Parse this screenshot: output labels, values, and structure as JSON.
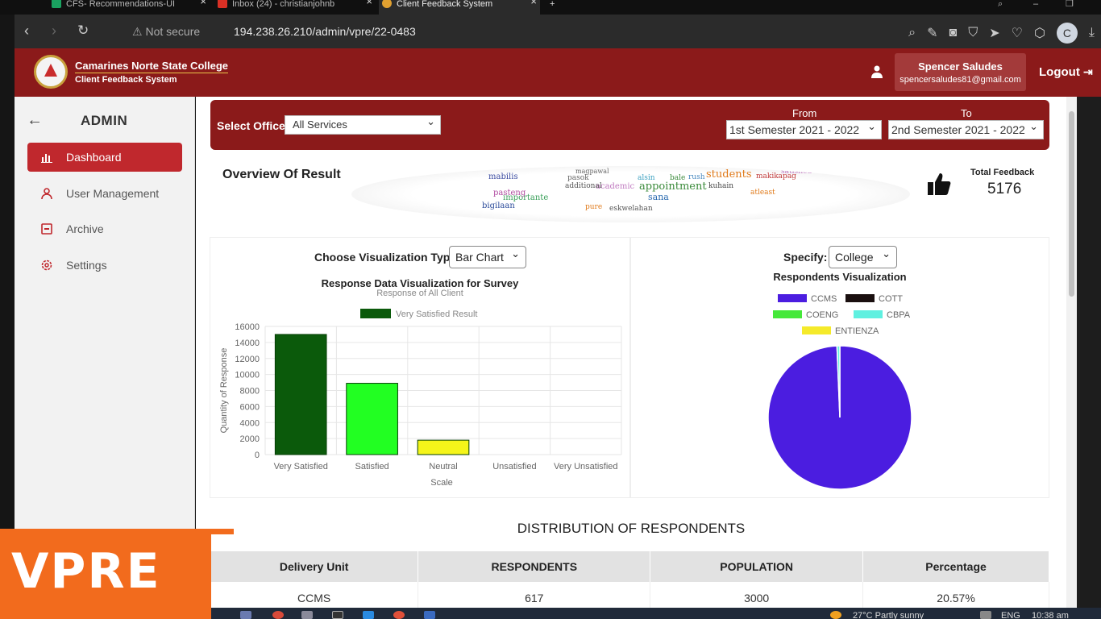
{
  "browser": {
    "tabs": [
      {
        "title": "CFS- Recommendations-UI",
        "favicon_color": "#1aa260"
      },
      {
        "title": "Inbox (24) - christianjohnb",
        "favicon_color": "#d93025"
      },
      {
        "title": "Client Feedback System",
        "favicon_color": "#e0a030"
      }
    ],
    "security": "Not secure",
    "url": "194.238.26.210/admin/vpre/22-0483",
    "profile_initial": "C"
  },
  "header": {
    "brand_title": "Camarines Norte State College",
    "brand_subtitle": "Client Feedback System",
    "user_name": "Spencer Saludes",
    "user_email": "spencersaludes81@gmail.com",
    "logout_label": "Logout"
  },
  "sidebar": {
    "title": "ADMIN",
    "items": [
      {
        "label": "Dashboard",
        "icon": "bar-chart-icon",
        "active": true
      },
      {
        "label": "User Management",
        "icon": "user-icon",
        "active": false
      },
      {
        "label": "Archive",
        "icon": "archive-icon",
        "active": false
      },
      {
        "label": "Settings",
        "icon": "gear-icon",
        "active": false
      }
    ]
  },
  "filters": {
    "office_label": "Select Office",
    "office_value": "All Services",
    "from_label": "From",
    "from_value": "1st Semester 2021 - 2022",
    "to_label": "To",
    "to_value": "2nd Semester 2021 - 2022"
  },
  "overview": {
    "title": "Overview Of Result",
    "total_label": "Total Feedback",
    "total_value": "5176",
    "word_cloud": [
      {
        "w": "appointment",
        "c": "#3a8a3a"
      },
      {
        "w": "students",
        "c": "#e07a1a"
      },
      {
        "w": "mabilis",
        "c": "#3a4aa0"
      },
      {
        "w": "sana",
        "c": "#2a6ab0"
      },
      {
        "w": "academic",
        "c": "#c07ac0"
      },
      {
        "w": "additional",
        "c": "#555"
      },
      {
        "w": "importante",
        "c": "#3aa05a"
      },
      {
        "w": "bigilaan",
        "c": "#2a4a9a"
      },
      {
        "w": "pasteng",
        "c": "#b04aa0"
      },
      {
        "w": "makikapag",
        "c": "#c03a3a"
      },
      {
        "w": "kuhain",
        "c": "#444"
      },
      {
        "w": "pasok",
        "c": "#666"
      },
      {
        "w": "atleast",
        "c": "#e07a1a"
      },
      {
        "w": "pure",
        "c": "#e07a1a"
      },
      {
        "w": "satisfied",
        "c": "#c07ac0"
      },
      {
        "w": "alsin",
        "c": "#3aa0c0"
      },
      {
        "w": "bale",
        "c": "#3a8a3a"
      },
      {
        "w": "rush",
        "c": "#4a8ac0"
      },
      {
        "w": "eskwelahan",
        "c": "#555"
      },
      {
        "w": "magpawal",
        "c": "#666"
      }
    ]
  },
  "left_chart": {
    "control_label": "Choose Visualization Type",
    "control_value": "Bar Chart"
  },
  "right_chart": {
    "control_label": "Specify:",
    "control_value": "College"
  },
  "chart_data": [
    {
      "type": "bar",
      "title": "Response Data Visualization for Survey",
      "subtitle": "Response of All Client",
      "legend": [
        "Very Satisfied Result"
      ],
      "categories": [
        "Very Satisfied",
        "Satisfied",
        "Neutral",
        "Unsatisfied",
        "Very Unsatisfied"
      ],
      "values": [
        15000,
        8900,
        1800,
        0,
        0
      ],
      "colors": [
        "#0b5a0b",
        "#22ff22",
        "#f5f51a",
        "#cccccc",
        "#cccccc"
      ],
      "xlabel": "Scale",
      "ylabel": "Quantity of Response",
      "ylim": [
        0,
        16000
      ],
      "yticks": [
        0,
        2000,
        4000,
        6000,
        8000,
        10000,
        12000,
        14000,
        16000
      ],
      "grid": true,
      "legend_position": "top"
    },
    {
      "type": "pie",
      "title": "Respondents Visualization",
      "labels": [
        "CCMS",
        "COTT",
        "COENG",
        "CBPA",
        "ENTIENZA"
      ],
      "values": [
        617,
        0,
        0,
        4,
        0
      ],
      "colors": [
        "#4b1de0",
        "#1a0f0f",
        "#45e83a",
        "#5ff0e0",
        "#f5ea2a"
      ],
      "legend_position": "top"
    }
  ],
  "distribution": {
    "title": "DISTRIBUTION OF RESPONDENTS",
    "columns": [
      "Delivery Unit",
      "RESPONDENTS",
      "POPULATION",
      "Percentage"
    ],
    "rows": [
      [
        "CCMS",
        "617",
        "3000",
        "20.57%"
      ]
    ]
  },
  "overlay": {
    "badge_text": "VPRE"
  },
  "taskbar": {
    "weather": "27°C  Partly sunny",
    "lang": "ENG",
    "clock": "10:38 am"
  }
}
